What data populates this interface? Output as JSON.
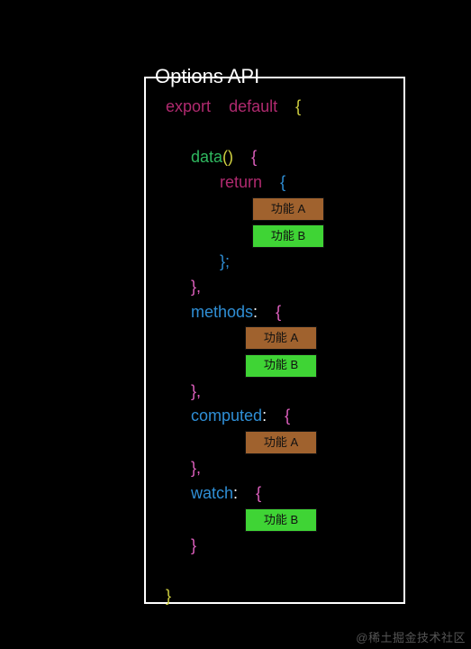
{
  "panel": {
    "legend": "Options API"
  },
  "code": {
    "export_kw": "export",
    "default_kw": "default",
    "brace_open": "{",
    "brace_close": "}",
    "data_kw": "data",
    "parens": "()",
    "return_kw": "return",
    "semicolon": ";",
    "close_brace_comma_close": "}",
    "comma": ",",
    "methods_kw": "methods",
    "computed_kw": "computed",
    "watch_kw": "watch",
    "colon": ":"
  },
  "tags": {
    "feature_a": "功能 A",
    "feature_b": "功能 B"
  },
  "watermark": "@稀土掘金技术社区"
}
